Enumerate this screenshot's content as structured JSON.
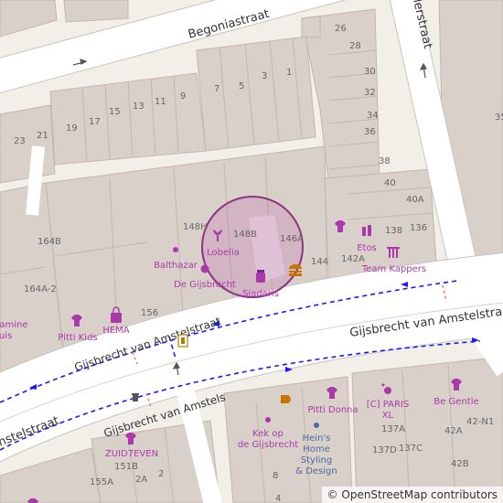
{
  "map": {
    "streets": {
      "begoniastraat": "Begoniastraat",
      "gijsbrecht_main": "Gijsbrecht van Amstelstraat",
      "gijsbrecht_upper": "Gijsbrecht van Amstelstraat",
      "gijsbrecht_lower": "Gijsbrecht van Amstels",
      "left_fragment": "nstelstraat",
      "right_vertical": "lerstraat"
    },
    "house_numbers": {
      "n26": "26",
      "n28": "28",
      "n30": "30",
      "n32": "32",
      "n34": "34",
      "n36": "36",
      "n38": "38",
      "n40": "40",
      "n40A": "40A",
      "n138": "138",
      "n136": "136",
      "n142A": "142A",
      "n144": "144",
      "n146A": "146A",
      "n148B": "148B",
      "n148H": "148H",
      "n164B": "164B",
      "n164A2": "164A-2",
      "n156": "156",
      "n1": "1",
      "n3": "3",
      "n5": "5",
      "n7": "7",
      "n9": "9",
      "n11": "11",
      "n13": "13",
      "n15": "15",
      "n17": "17",
      "n19": "19",
      "n21": "21",
      "n23": "23",
      "n137A": "137A",
      "n137D": "137D",
      "n137C": "137C",
      "n42A": "42A",
      "n42B": "42B",
      "n42N1": "42-N1",
      "n151B": "151B",
      "n155A": "155A",
      "n2A": "2A",
      "n2": "2",
      "n8": "8",
      "n4": "4",
      "n35top": "35"
    },
    "pois": {
      "lobelia": "Lobelia",
      "siadaris": "Siadaris",
      "de_gijsbrecht": "De Gijsbrecht",
      "balthazar": "Balthazar",
      "pitti_kids": "Pitti Kids",
      "hema": "HEMA",
      "etos": "Etos",
      "team_kappers": "Team Kappers",
      "vitamine": "tamine",
      "vitamine2": "uis",
      "kek": "Kek op",
      "kek2": "de Gijsbrecht",
      "pitti_donna": "Pitti Donna",
      "ic_paris": "[C] PARIS",
      "ic_paris2": "XL",
      "be_gentle": "Be Gentle",
      "heins1": "Hein's",
      "heins2": "Home",
      "heins3": "Styling",
      "heins4": "& Design",
      "zuid7even": "ZUID7EVEN"
    },
    "colors": {
      "land": "#f2efe9",
      "building": "#d9d0c9",
      "building_stroke": "#c4b6ab",
      "road": "#ffffff",
      "poi": "#ac39ac",
      "bus_route": "#1a1aff",
      "highlight": "#c060b0"
    }
  },
  "attribution": {
    "copyright": "©",
    "text": "OpenStreetMap contributors"
  }
}
